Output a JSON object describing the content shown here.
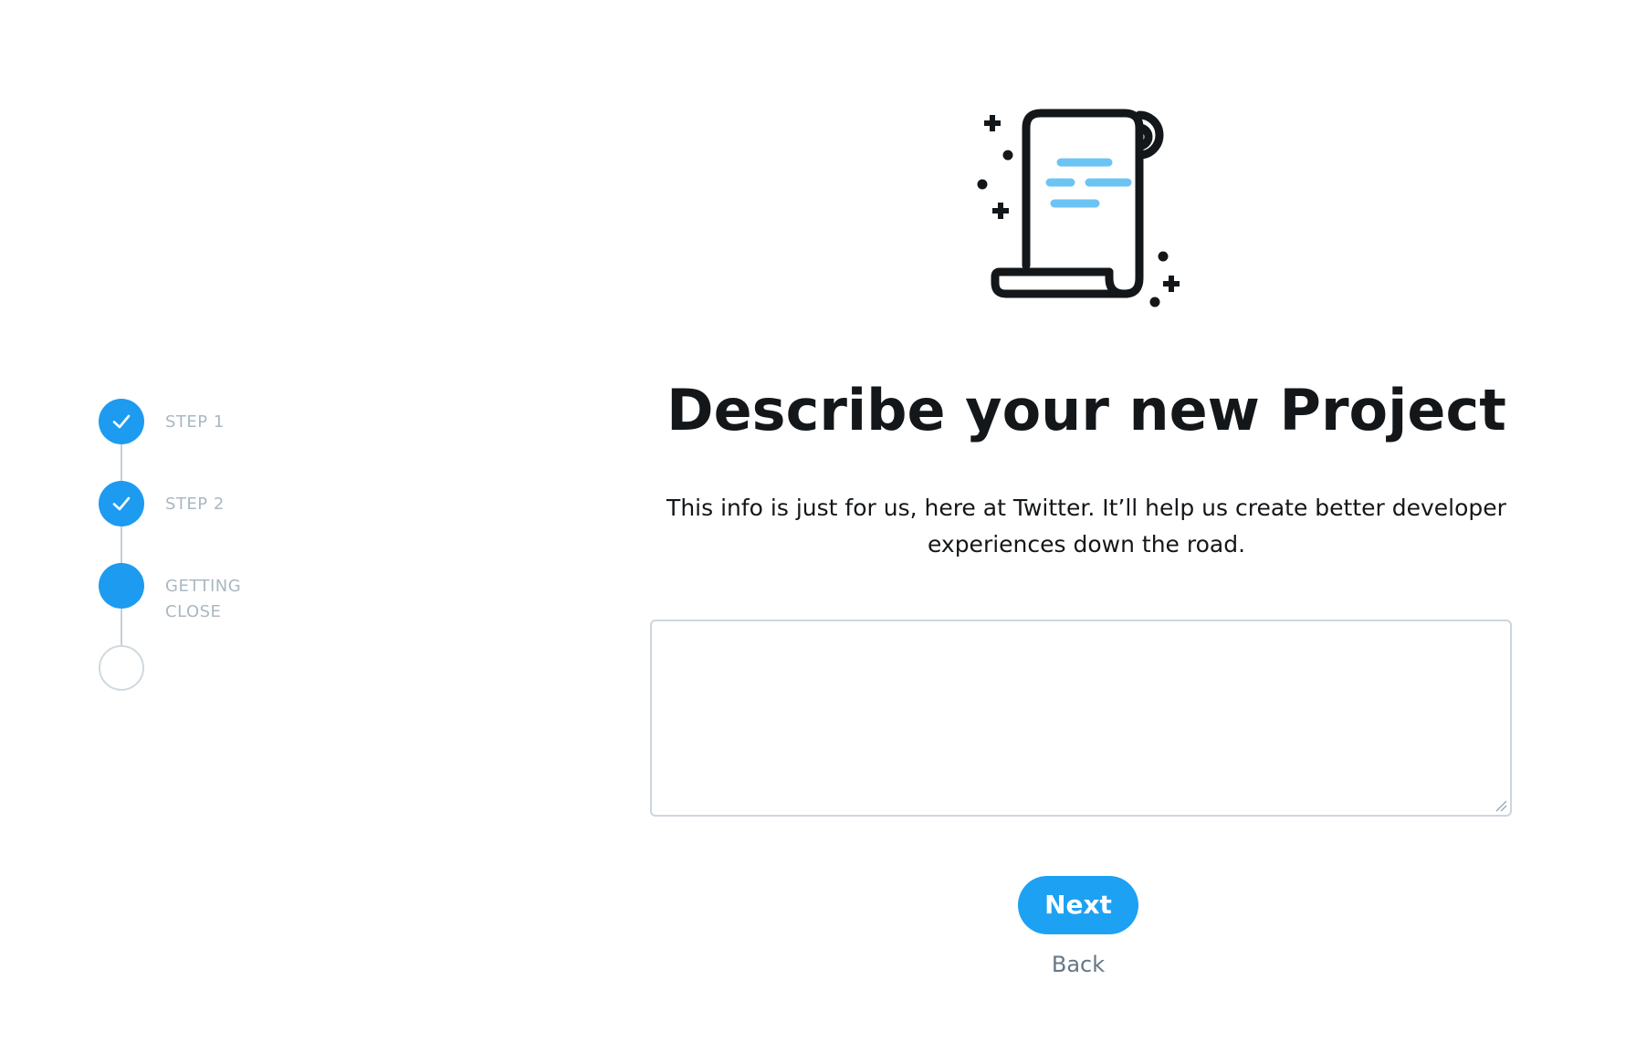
{
  "stepper": {
    "steps": [
      {
        "label": "STEP 1",
        "state": "complete"
      },
      {
        "label": "STEP 2",
        "state": "complete"
      },
      {
        "label": "GETTING\nCLOSE",
        "state": "current"
      },
      {
        "label": "",
        "state": "upcoming"
      }
    ]
  },
  "hero": {
    "icon": "scroll-icon"
  },
  "main": {
    "title": "Describe your new Project",
    "subtitle": "This info is just for us, here at Twitter. It’ll help us create better developer experiences down the road.",
    "description_value": "",
    "next_label": "Next",
    "back_label": "Back"
  },
  "colors": {
    "accent": "#1d9bf0",
    "button": "#1da1f2",
    "illustration_lines": "#6cc4f4",
    "title": "#14171a",
    "muted": "#aab8c2"
  }
}
